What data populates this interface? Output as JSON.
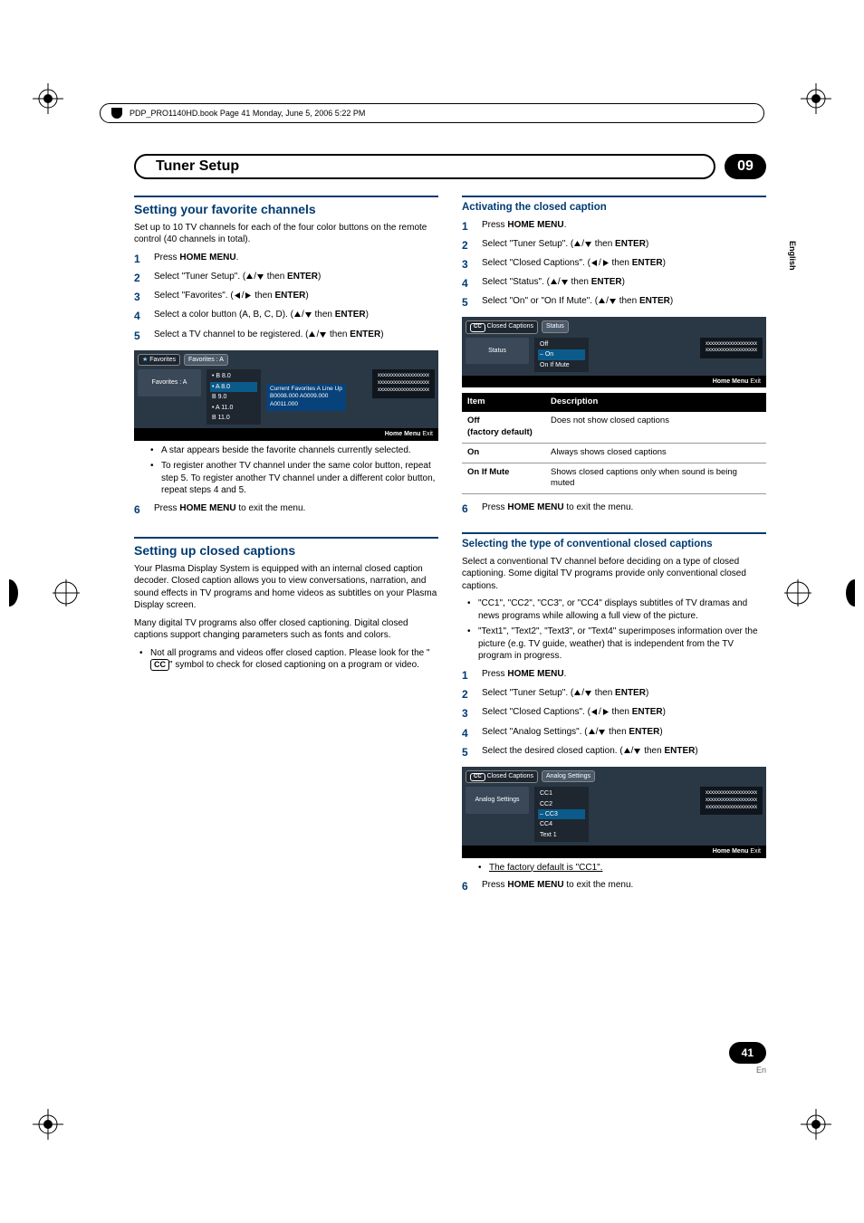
{
  "book_header": "PDP_PRO1140HD.book  Page 41  Monday, June 5, 2006  5:22 PM",
  "running": {
    "title": "Tuner Setup",
    "chapter": "09"
  },
  "side_tab": "English",
  "page_num": "41",
  "page_lang": "En",
  "left": {
    "sec1_title": "Setting your favorite channels",
    "sec1_intro": "Set up to 10 TV channels for each of the four color buttons on the remote control (40 channels in total).",
    "s1_1": "Press ",
    "s1_1_b": "HOME MENU",
    "s1_1_tail": ".",
    "s1_2": "Select \"Tuner Setup\". (",
    "s1_2_tail": " then ",
    "s1_2_b": "ENTER",
    "s1_2_end": ")",
    "s1_3": "Select \"Favorites\". (",
    "s1_3_tail": " then ",
    "s1_3_b": "ENTER",
    "s1_3_end": ")",
    "s1_4": "Select a color button (A, B, C, D). (",
    "s1_4_tail": " then ",
    "s1_4_b": "ENTER",
    "s1_4_end": ")",
    "s1_5": "Select a TV channel to be registered. (",
    "s1_5_tail": " then ",
    "s1_5_b": "ENTER",
    "s1_5_end": ")",
    "osd1": {
      "crumb1": "Favorites",
      "crumb2": "Favorites : A",
      "left": "Favorites : A",
      "list": [
        "• B      8.0",
        "• A      8.0",
        "  B      9.0",
        "• A    11.0",
        "  B    11.0"
      ],
      "mid1": "Current Favorites A Line Up",
      "mid2": "B0008.000        A0009.000",
      "mid3": "A0011.000",
      "right1": "xxxxxxxxxxxxxxxxxxx",
      "right2": "xxxxxxxxxxxxxxxxxxx",
      "right3": "xxxxxxxxxxxxxxxxxxx",
      "foot_l": "Home Menu",
      "foot_r": "Exit"
    },
    "s1_b1": "A star appears beside the favorite channels currently selected.",
    "s1_b2": "To register another TV channel under the same color button, repeat step 5. To register another TV channel under a different color button, repeat steps 4 and 5.",
    "s1_6": "Press ",
    "s1_6_b": "HOME MENU",
    "s1_6_tail": " to exit the menu.",
    "sec2_title": "Setting up closed captions",
    "sec2_p1": "Your Plasma Display System is equipped with an internal closed caption decoder. Closed caption allows you to view conversations, narration, and sound effects in TV programs and home videos as subtitles on your Plasma Display screen.",
    "sec2_p2": "Many digital TV programs also offer closed captioning. Digital closed captions support changing parameters such as fonts and colors.",
    "sec2_b1_a": "Not all programs and videos offer closed caption. Please look for the \"",
    "sec2_b1_cc": "CC",
    "sec2_b1_b": "\" symbol to check for closed captioning on a program or video."
  },
  "right": {
    "sub1": "Activating the closed caption",
    "r1_1": "Press ",
    "r1_1_b": "HOME MENU",
    "r1_1_tail": ".",
    "r1_2": "Select \"Tuner Setup\". (",
    "r1_2_tail": " then ",
    "r1_2_b": "ENTER",
    "r1_2_end": ")",
    "r1_3": "Select \"Closed Captions\". (",
    "r1_3_tail": " then ",
    "r1_3_b": "ENTER",
    "r1_3_end": ")",
    "r1_4": "Select \"Status\". (",
    "r1_4_tail": " then ",
    "r1_4_b": "ENTER",
    "r1_4_end": ")",
    "r1_5": "Select \"On\" or \"On If Mute\". (",
    "r1_5_tail": " then ",
    "r1_5_b": "ENTER",
    "r1_5_end": ")",
    "osd2": {
      "crumb1": "Closed Captions",
      "crumb2": "Status",
      "left": "Status",
      "list": [
        "Off",
        "– On",
        "On If Mute"
      ],
      "right1": "xxxxxxxxxxxxxxxxxxx",
      "right2": "xxxxxxxxxxxxxxxxxxx",
      "foot_l": "Home Menu",
      "foot_r": "Exit"
    },
    "tbl": {
      "h1": "Item",
      "h2": "Description",
      "r1k": "Off\n(factory default)",
      "r1v": "Does not show closed captions",
      "r2k": "On",
      "r2v": "Always shows closed captions",
      "r3k": "On If Mute",
      "r3v": "Shows closed captions only when sound is being muted"
    },
    "r1_6": "Press ",
    "r1_6_b": "HOME MENU",
    "r1_6_tail": " to exit the menu.",
    "sub2": "Selecting the type of conventional closed captions",
    "r2_p1": "Select a conventional TV channel before deciding on a type of closed captioning. Some digital TV programs provide only conventional closed captions.",
    "r2_b1": "\"CC1\", \"CC2\", \"CC3\", or \"CC4\" displays subtitles of TV dramas and news programs while allowing a full view of the picture.",
    "r2_b2": "\"Text1\", \"Text2\", \"Text3\", or \"Text4\" superimposes information over the picture (e.g. TV guide, weather) that is independent from the TV program in progress.",
    "r2_1": "Press ",
    "r2_1_b": "HOME MENU",
    "r2_1_tail": ".",
    "r2_2": "Select \"Tuner Setup\". (",
    "r2_2_tail": " then ",
    "r2_2_b": "ENTER",
    "r2_2_end": ")",
    "r2_3": "Select \"Closed Captions\". (",
    "r2_3_tail": " then ",
    "r2_3_b": "ENTER",
    "r2_3_end": ")",
    "r2_4": "Select \"Analog Settings\". (",
    "r2_4_tail": " then ",
    "r2_4_b": "ENTER",
    "r2_4_end": ")",
    "r2_5": "Select the desired closed caption. (",
    "r2_5_tail": " then ",
    "r2_5_b": "ENTER",
    "r2_5_end": ")",
    "osd3": {
      "crumb1": "Closed Captions",
      "crumb2": "Analog Settings",
      "left": "Analog Settings",
      "list": [
        "CC1",
        "CC2",
        "– CC3",
        "CC4",
        "Text 1"
      ],
      "right1": "xxxxxxxxxxxxxxxxxxx",
      "right2": "xxxxxxxxxxxxxxxxxxx",
      "right3": "xxxxxxxxxxxxxxxxxxx",
      "foot_l": "Home Menu",
      "foot_r": "Exit"
    },
    "r2_note": "The factory default is \"CC1\".",
    "r2_6": "Press ",
    "r2_6_b": "HOME MENU",
    "r2_6_tail": " to exit the menu."
  }
}
